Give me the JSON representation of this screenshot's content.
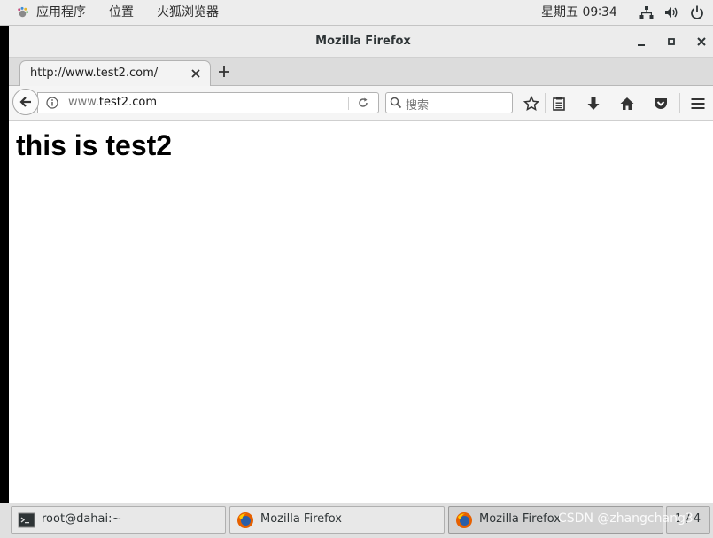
{
  "topbar": {
    "apps_menu": "应用程序",
    "places_menu": "位置",
    "browser_menu": "火狐浏览器",
    "clock": "星期五 09∶34",
    "icons": [
      "network-icon",
      "volume-icon",
      "power-icon"
    ]
  },
  "window": {
    "title": "Mozilla Firefox"
  },
  "tab": {
    "label": "http://www.test2.com/"
  },
  "navbar": {
    "url_prefix": "www.",
    "url_domain": "test2.com",
    "search_placeholder": "搜索"
  },
  "page": {
    "heading": "this is test2"
  },
  "taskbar": {
    "items": [
      {
        "label": "root@dahai:~",
        "icon": "terminal-icon"
      },
      {
        "label": "Mozilla Firefox",
        "icon": "firefox-icon"
      },
      {
        "label": "Mozilla Firefox",
        "icon": "firefox-icon"
      }
    ],
    "workspace": "1 / 4",
    "watermark": "CSDN @zhangchang3"
  },
  "colors": {
    "topbar_bg": "#ededed",
    "window_bg": "#ffffff",
    "taskbar_bg": "#e0e0e0"
  }
}
